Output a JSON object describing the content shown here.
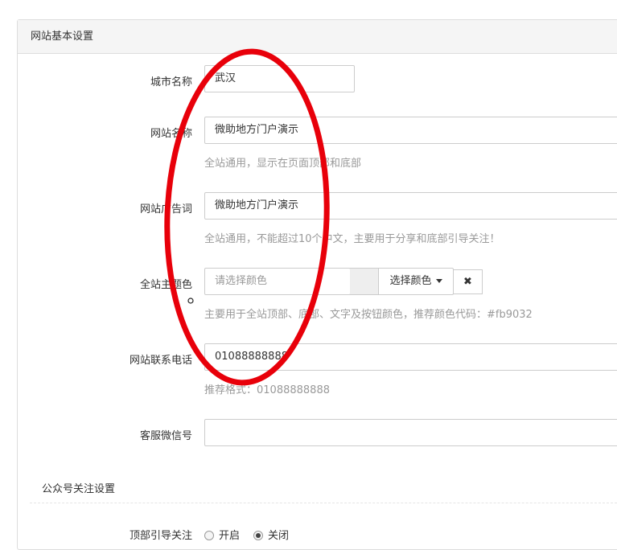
{
  "panel": {
    "title": "网站基本设置"
  },
  "form": {
    "city": {
      "label": "城市名称",
      "value": "武汉"
    },
    "site_name": {
      "label": "网站名称",
      "value": "微助地方门户演示",
      "help": "全站通用，显示在页面顶部和底部"
    },
    "ad_slogan": {
      "label": "网站广告词",
      "value": "微助地方门户演示",
      "help": "全站通用，不能超过10个中文，主要用于分享和底部引导关注！"
    },
    "theme_color": {
      "label": "全站主题色",
      "placeholder": "请选择颜色",
      "select_button": "选择颜色",
      "clear_button": "✖",
      "help": "主要用于全站顶部、底部、文字及按钮颜色，推荐颜色代码：#fb9032",
      "swatch_color": "#eeeeee"
    },
    "phone": {
      "label": "网站联系电话",
      "value": "01088888888",
      "help": "推荐格式：01088888888"
    },
    "wechat": {
      "label": "客服微信号",
      "value": ""
    }
  },
  "follow_section": {
    "title": "公众号关注设置",
    "top_guide": {
      "label": "顶部引导关注",
      "options": [
        {
          "label": "开启",
          "checked": false
        },
        {
          "label": "关闭",
          "checked": true
        }
      ]
    }
  },
  "annotation": {
    "color": "#e8000a"
  }
}
